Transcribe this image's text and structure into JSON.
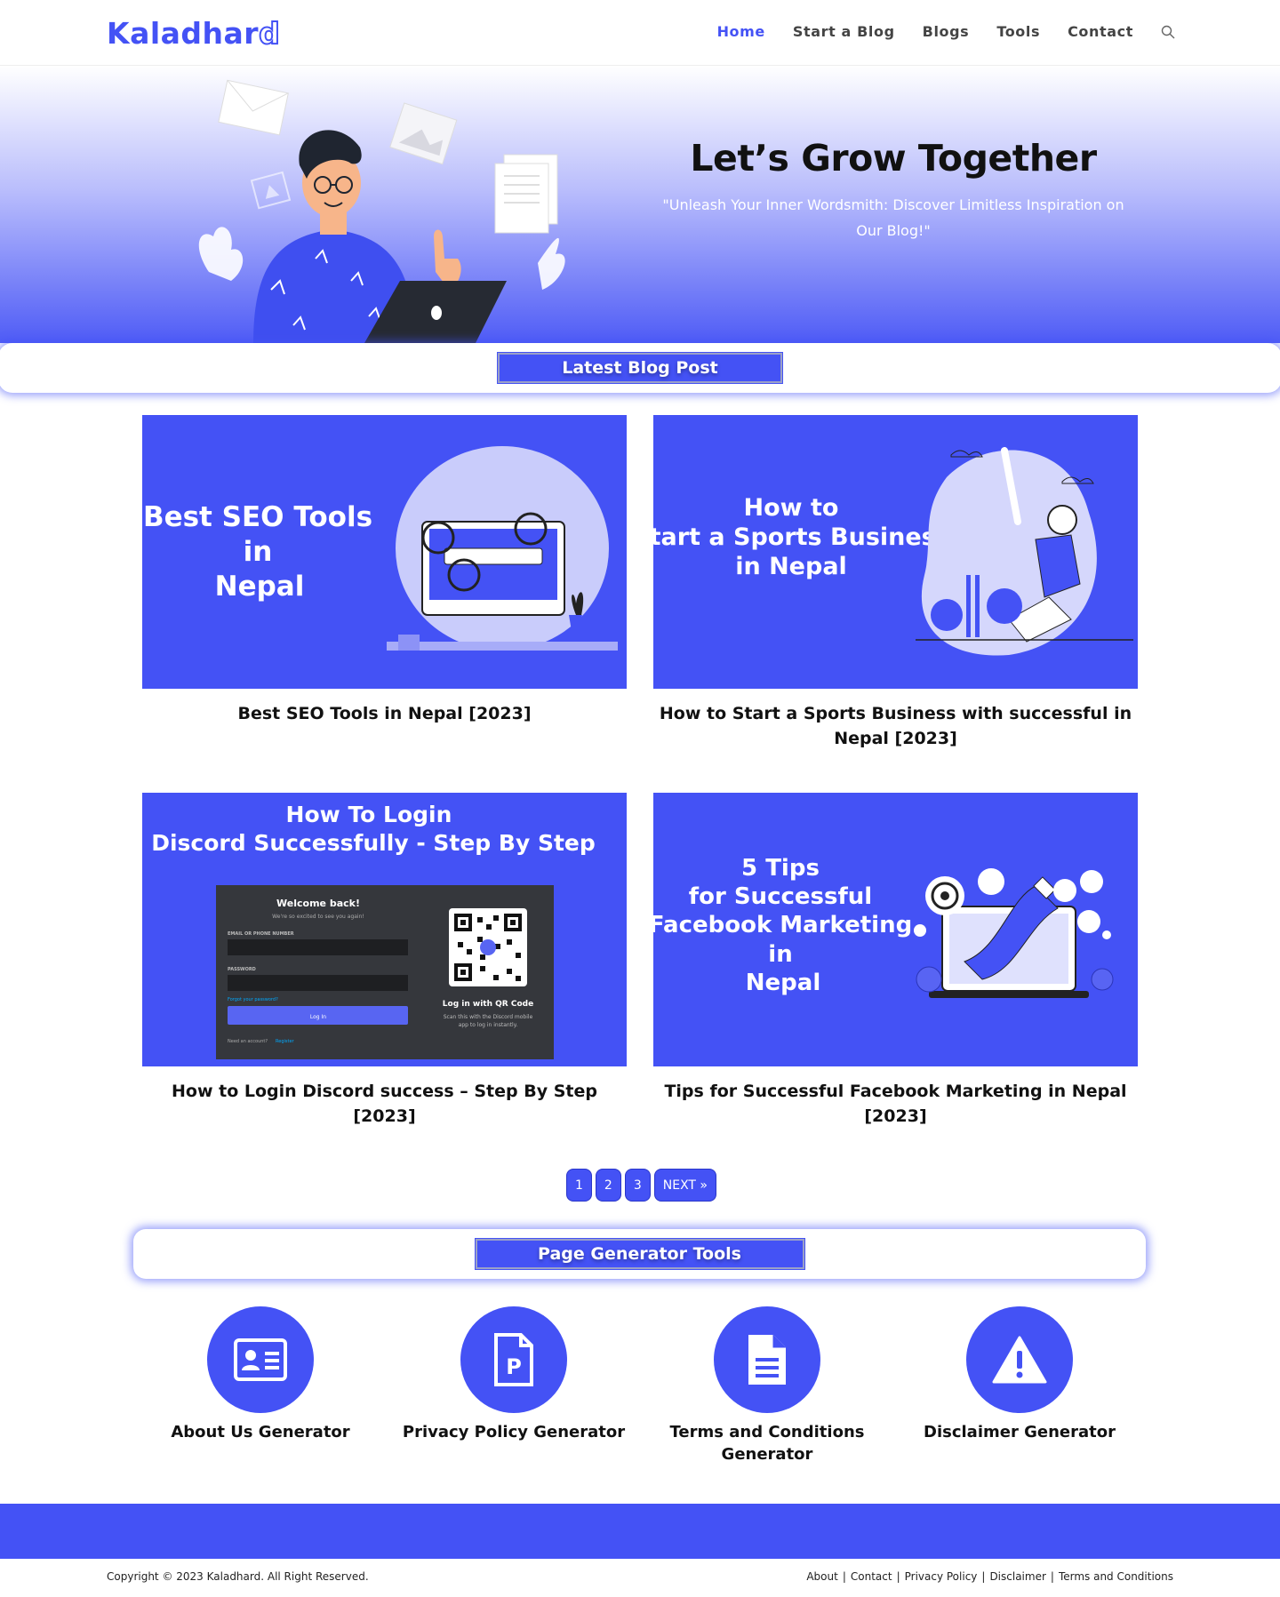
{
  "site": {
    "logo_text": "Kaladhar",
    "logo_last": "d"
  },
  "nav": {
    "items": [
      {
        "label": "Home",
        "active": true
      },
      {
        "label": "Start a Blog",
        "active": false
      },
      {
        "label": "Blogs",
        "active": false
      },
      {
        "label": "Tools",
        "active": false
      },
      {
        "label": "Contact",
        "active": false
      }
    ],
    "search_icon": "search-icon"
  },
  "hero": {
    "title": "Let’s Grow Together",
    "subtitle": "\"Unleash Your Inner Wordsmith: Discover Limitless Inspiration on Our Blog!\""
  },
  "latest": {
    "heading": "Latest Blog Post",
    "posts": [
      {
        "title": "Best SEO Tools in Nepal [2023]",
        "thumb_lines": [
          "Best SEO Tools",
          "in",
          "Nepal"
        ]
      },
      {
        "title": "How to Start a Sports Business with successful in Nepal [2023]",
        "thumb_lines": [
          "How to",
          "Start a Sports Business",
          "in Nepal"
        ]
      },
      {
        "title": "How to Login Discord success – Step By Step [2023]",
        "thumb_lines": [
          "How To Login",
          "Discord Successfully - Step By Step"
        ],
        "screen": {
          "welcome": "Welcome back!",
          "welcome_sub": "We're so excited to see you again!",
          "email_label": "EMAIL OR PHONE NUMBER",
          "password_label": "PASSWORD",
          "forgot": "Forgot your password?",
          "login_btn": "Log In",
          "need_account": "Need an account?",
          "register": "Register",
          "qr_title": "Log in with QR Code",
          "qr_sub_1": "Scan this with the Discord mobile",
          "qr_sub_2": "app to log in instantly."
        }
      },
      {
        "title": "Tips for Successful Facebook Marketing in Nepal [2023]",
        "thumb_lines": [
          "5 Tips",
          "for Successful",
          "Facebook Marketing",
          "in",
          "Nepal"
        ]
      }
    ]
  },
  "pagination": {
    "pages": [
      "1",
      "2",
      "3"
    ],
    "next": "NEXT »"
  },
  "tools": {
    "heading": "Page Generator Tools",
    "items": [
      {
        "label": "About Us Generator",
        "icon": "id-card-icon"
      },
      {
        "label": "Privacy Policy Generator",
        "icon": "policy-document-icon"
      },
      {
        "label": "Terms and Conditions Generator",
        "icon": "document-icon"
      },
      {
        "label": "Disclaimer Generator",
        "icon": "warning-icon"
      }
    ]
  },
  "footer": {
    "copyright": "Copyright © 2023 Kaladhard. All Right Reserved.",
    "links": [
      "About",
      "Contact",
      "Privacy Policy",
      "Disclaimer",
      "Terms and Conditions"
    ]
  },
  "colors": {
    "accent": "#4452f5",
    "text": "#111111",
    "nav_text": "#444444"
  }
}
